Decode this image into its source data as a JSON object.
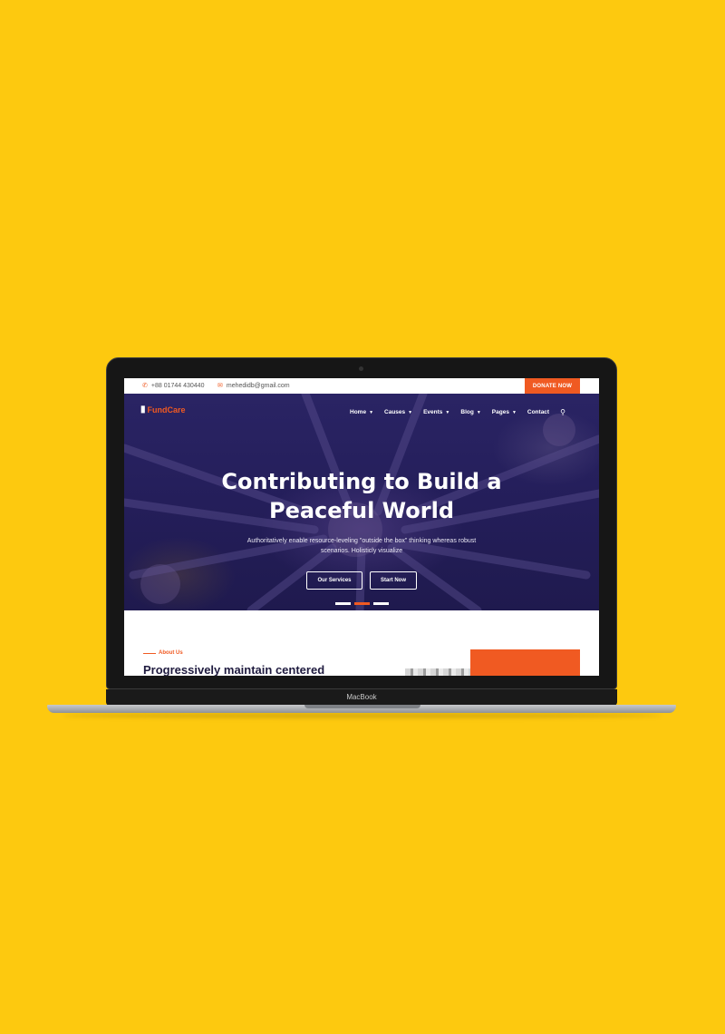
{
  "colors": {
    "background": "#fdc90f",
    "accent": "#f05a22",
    "hero": "#241e5a"
  },
  "laptop": {
    "brand": "MacBook"
  },
  "topbar": {
    "phone": "+88 01744 430440",
    "phone_icon": "phone-icon",
    "email": "mehedidb@gmail.com",
    "email_icon": "envelope-icon",
    "donate_label": "DONATE NOW"
  },
  "logo": {
    "text": "FundCare"
  },
  "nav": {
    "items": [
      {
        "label": "Home",
        "dropdown": true
      },
      {
        "label": "Causes",
        "dropdown": true
      },
      {
        "label": "Events",
        "dropdown": true
      },
      {
        "label": "Blog",
        "dropdown": true
      },
      {
        "label": "Pages",
        "dropdown": true
      },
      {
        "label": "Contact",
        "dropdown": false
      }
    ],
    "search_icon": "search-icon"
  },
  "hero": {
    "title_line1": "Contributing to Build a",
    "title_line2": "Peaceful World",
    "subtitle_line1": "Authoritatively enable resource-leveling \"outside the box\" thinking whereas robust",
    "subtitle_line2": "scenarios. Holisticly visualize",
    "primary_button": "Our Services",
    "secondary_button": "Start Now",
    "slides": 3,
    "active_slide": 2
  },
  "about": {
    "eyebrow": "About Us",
    "heading": "Progressively maintain centered"
  }
}
